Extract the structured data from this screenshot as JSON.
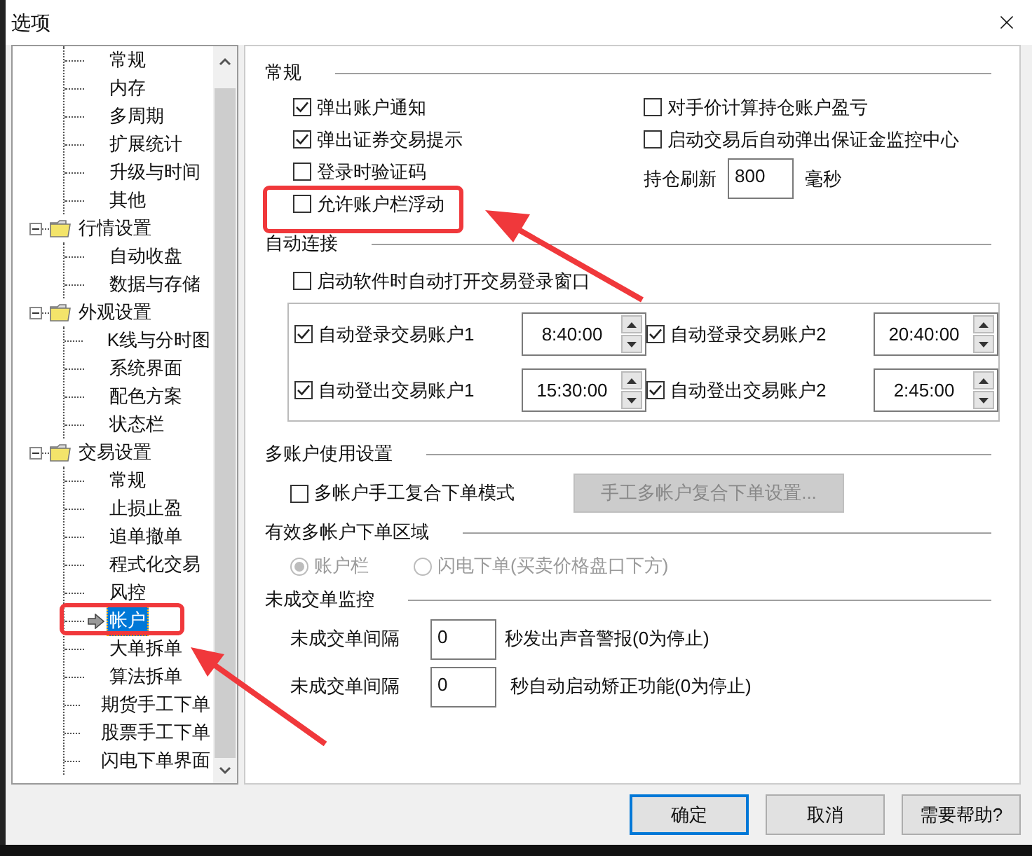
{
  "window": {
    "title": "选项"
  },
  "tree": [
    {
      "children": [
        {
          "label": "常规",
          "selected": false
        },
        {
          "label": "内存",
          "selected": false
        },
        {
          "label": "多周期",
          "selected": false
        },
        {
          "label": "扩展统计",
          "selected": false
        },
        {
          "label": "升级与时间",
          "selected": false
        },
        {
          "label": "其他",
          "selected": false
        }
      ]
    },
    {
      "label": "行情设置",
      "expanded": true,
      "children": [
        {
          "label": "自动收盘",
          "selected": false
        },
        {
          "label": "数据与存储",
          "selected": false
        }
      ]
    },
    {
      "label": "外观设置",
      "expanded": true,
      "children": [
        {
          "label": "K线与分时图",
          "selected": false
        },
        {
          "label": "系统界面",
          "selected": false
        },
        {
          "label": "配色方案",
          "selected": false
        },
        {
          "label": "状态栏",
          "selected": false
        }
      ]
    },
    {
      "label": "交易设置",
      "expanded": true,
      "children": [
        {
          "label": "常规",
          "selected": false
        },
        {
          "label": "止损止盈",
          "selected": false
        },
        {
          "label": "追单撤单",
          "selected": false
        },
        {
          "label": "程式化交易",
          "selected": false
        },
        {
          "label": "风控",
          "selected": false
        },
        {
          "label": "帐户",
          "selected": true
        },
        {
          "label": "大单拆单",
          "selected": false
        },
        {
          "label": "算法拆单",
          "selected": false
        },
        {
          "label": "期货手工下单",
          "selected": false
        },
        {
          "label": "股票手工下单",
          "selected": false
        },
        {
          "label": "闪电下单界面",
          "selected": false
        }
      ]
    }
  ],
  "general": {
    "title": "常规",
    "left_options": [
      {
        "label": "弹出账户通知",
        "checked": true
      },
      {
        "label": "弹出证券交易提示",
        "checked": true
      },
      {
        "label": "登录时验证码",
        "checked": false
      },
      {
        "label": "允许账户栏浮动",
        "checked": false
      }
    ],
    "right_options": [
      {
        "label": "对手价计算持仓账户盈亏",
        "checked": false
      },
      {
        "label": "启动交易后自动弹出保证金监控中心",
        "checked": false
      }
    ],
    "refresh": {
      "label": "持仓刷新",
      "value": "800",
      "unit": "毫秒"
    }
  },
  "auto_connect": {
    "title": "自动连接",
    "startup": {
      "label": "启动软件时自动打开交易登录窗口",
      "checked": false
    },
    "accounts": [
      {
        "label": "自动登录交易账户1",
        "checked": true,
        "time": "8:40:00"
      },
      {
        "label": "自动登录交易账户2",
        "checked": true,
        "time": "20:40:00"
      },
      {
        "label": "自动登出交易账户1",
        "checked": true,
        "time": "15:30:00"
      },
      {
        "label": "自动登出交易账户2",
        "checked": true,
        "time": "2:45:00"
      }
    ]
  },
  "multi_account": {
    "title": "多账户使用设置",
    "mode": {
      "label": "多帐户手工复合下单模式",
      "checked": false
    },
    "button": {
      "label": "手工多帐户复合下单设置...",
      "disabled": true
    }
  },
  "order_area": {
    "title": "有效多帐户下单区域",
    "options": [
      {
        "label": "账户栏",
        "selected": true,
        "disabled": true
      },
      {
        "label": "闪电下单(买卖价格盘口下方)",
        "selected": false,
        "disabled": true
      }
    ]
  },
  "monitor": {
    "title": "未成交单监控",
    "rows": [
      {
        "label": "未成交单间隔",
        "value": "0",
        "suffix": "秒发出声音警报(0为停止)"
      },
      {
        "label": "未成交单间隔",
        "value": "0",
        "suffix": "秒自动启动矫正功能(0为停止)"
      }
    ]
  },
  "buttons": [
    {
      "label": "确定",
      "default": true
    },
    {
      "label": "取消",
      "default": false
    },
    {
      "label": "需要帮助?",
      "default": false
    }
  ]
}
